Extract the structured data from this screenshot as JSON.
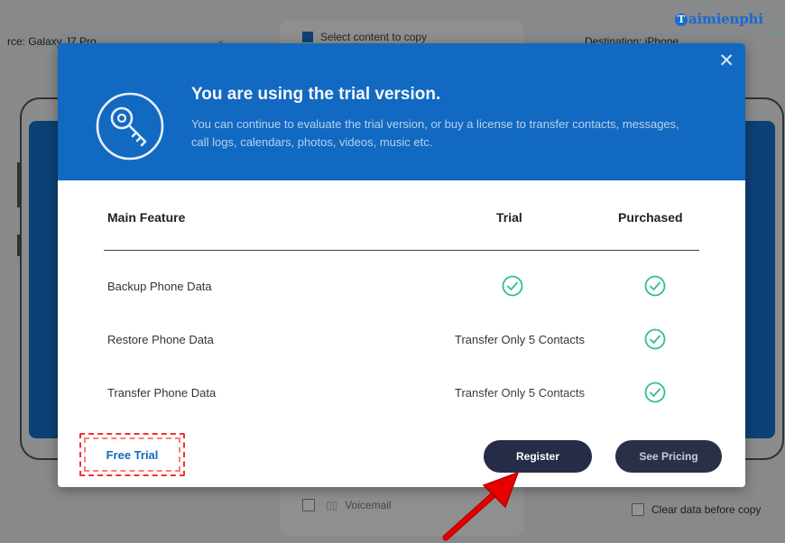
{
  "app": {
    "source_label": "rce: Galaxy J7 Pro",
    "select_content_label": "Select content to copy",
    "destination_label": "Destination: iPhone",
    "voicemail_label": "Voicemail",
    "clear_data_label": "Clear data before copy"
  },
  "watermark": {
    "logo_initial": "T",
    "logo_text": "aimienphi",
    "logo_sub": ".vn"
  },
  "dialog": {
    "close_glyph": "✕",
    "title": "You are using the trial version.",
    "description": "You can continue to evaluate the trial version, or buy a license to transfer contacts, messages, call logs, calendars, photos, videos, music etc.",
    "columns": {
      "feature": "Main Feature",
      "trial": "Trial",
      "purchased": "Purchased"
    },
    "rows": [
      {
        "feature": "Backup Phone Data",
        "trial": "",
        "trial_check": true,
        "purchased_check": true
      },
      {
        "feature": "Restore Phone Data",
        "trial": "Transfer Only 5 Contacts",
        "trial_check": false,
        "purchased_check": true
      },
      {
        "feature": "Transfer Phone Data",
        "trial": "Transfer Only 5 Contacts",
        "trial_check": false,
        "purchased_check": true
      }
    ],
    "buttons": {
      "free_trial": "Free Trial",
      "register": "Register",
      "see_pricing": "See Pricing"
    }
  },
  "icons": {
    "key": "key-icon",
    "check": "check-circle-icon",
    "close": "close-icon",
    "arrow": "red-arrow-pointer"
  },
  "colors": {
    "header_blue": "#1269c1",
    "check_green": "#2fbf8f",
    "register_bg": "#262c48",
    "highlight_red": "#ff2a2a"
  }
}
